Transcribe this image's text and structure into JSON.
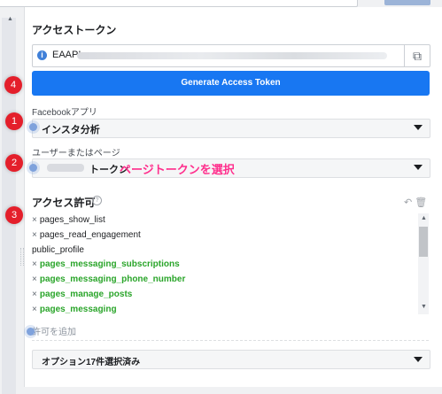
{
  "section_title": "アクセストークン",
  "token": {
    "value_prefix": "EAAPI",
    "copy_icon": "copy-icon"
  },
  "generate_button": "Generate Access Token",
  "app_field": {
    "label": "Facebookアプリ",
    "value": "インスタ分析"
  },
  "page_field": {
    "label": "ユーザーまたはページ",
    "value": "トークン"
  },
  "annotation": "ページトークンを選択",
  "badges": {
    "app": "1",
    "page": "2",
    "permissions": "3",
    "generate": "4"
  },
  "permissions": {
    "title": "アクセス許可",
    "items": [
      {
        "label": "pages_show_list",
        "removable": true,
        "highlight": false
      },
      {
        "label": "pages_read_engagement",
        "removable": true,
        "highlight": false
      },
      {
        "label": "public_profile",
        "removable": false,
        "highlight": false
      },
      {
        "label": "pages_messaging_subscriptions",
        "removable": true,
        "highlight": true
      },
      {
        "label": "pages_messaging_phone_number",
        "removable": true,
        "highlight": true
      },
      {
        "label": "pages_manage_posts",
        "removable": true,
        "highlight": true
      },
      {
        "label": "pages_messaging",
        "removable": true,
        "highlight": true
      }
    ],
    "add_label": "許可を追加"
  },
  "options_select": "オプション17件選択済み",
  "colors": {
    "accent": "#1877f2",
    "badge": "#e41f2b",
    "annotation": "#ff2e8c",
    "highlight": "#2aa52a"
  }
}
